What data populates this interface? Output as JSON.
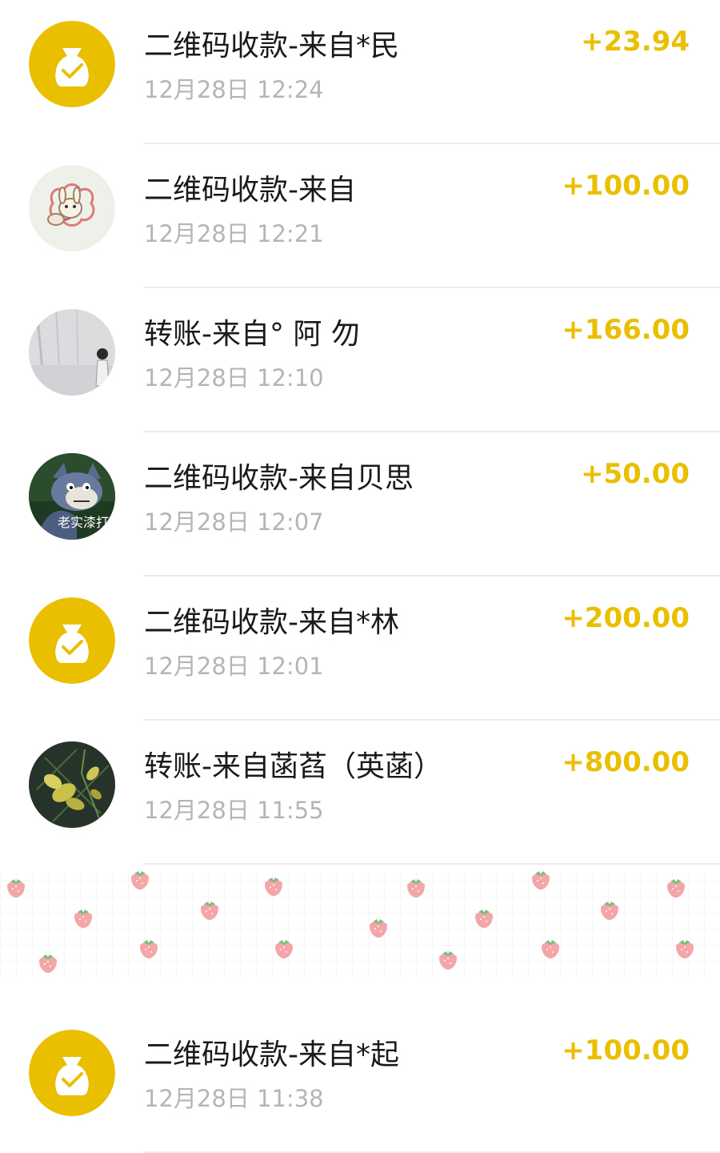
{
  "accent_color": "#eabf00",
  "transactions": [
    {
      "avatar": "money-bag-icon",
      "title": "二维码收款-来自*民",
      "time": "12月28日 12:24",
      "amount": "+23.94"
    },
    {
      "avatar": "avatar-cartoon-rabbit",
      "title": "二维码收款-来自",
      "time": "12月28日 12:21",
      "amount": "+100.00"
    },
    {
      "avatar": "avatar-photo-person",
      "title": "转账-来自° 阿 勿",
      "time": "12月28日 12:10",
      "amount": "+166.00"
    },
    {
      "avatar": "avatar-cartoon-cat",
      "title": "二维码收款-来自贝思",
      "time": "12月28日 12:07",
      "amount": "+50.00",
      "avatar_text": "老实漆打"
    },
    {
      "avatar": "money-bag-icon",
      "title": "二维码收款-来自*林",
      "time": "12月28日 12:01",
      "amount": "+200.00"
    },
    {
      "avatar": "avatar-flower",
      "title": "转账-来自菡萏（英菡）",
      "time": "12月28日 11:55",
      "amount": "+800.00"
    },
    {
      "avatar": "money-bag-icon",
      "title": "二维码收款-来自*起",
      "time": "12月28日 11:38",
      "amount": "+100.00"
    }
  ]
}
